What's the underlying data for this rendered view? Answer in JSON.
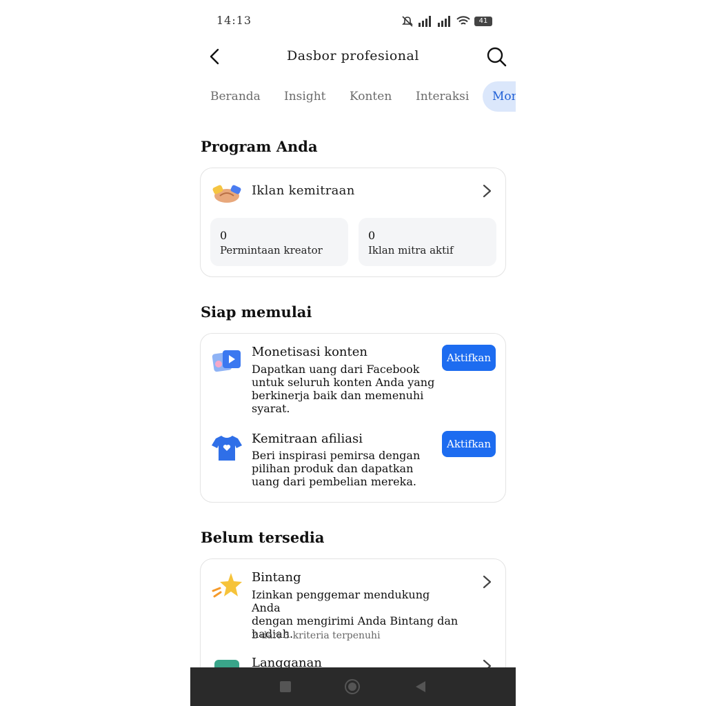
{
  "status_bar": {
    "time": "14:13",
    "battery": "41"
  },
  "header": {
    "title": "Dasbor profesional"
  },
  "tabs": [
    "Beranda",
    "Insight",
    "Konten",
    "Interaksi",
    "Mon"
  ],
  "program": {
    "section_title": "Program Anda",
    "card_title": "Iklan kemitraan",
    "stats": [
      {
        "value": "0",
        "label": "Permintaan kreator"
      },
      {
        "value": "0",
        "label": "Iklan mitra aktif"
      }
    ]
  },
  "ready": {
    "section_title": "Siap memulai",
    "items": [
      {
        "title": "Monetisasi konten",
        "desc_lines": [
          "Dapatkan uang dari Facebook",
          "untuk seluruh konten Anda yang",
          "berkinerja baik dan memenuhi",
          "syarat."
        ],
        "button": "Aktifkan",
        "icon": "video-monetization-icon"
      },
      {
        "title": "Kemitraan afiliasi",
        "desc_lines": [
          "Beri inspirasi pemirsa dengan",
          "pilihan produk dan dapatkan",
          "uang dari pembelian mereka."
        ],
        "button": "Aktifkan",
        "icon": "tshirt-icon"
      }
    ]
  },
  "unavailable": {
    "section_title": "Belum tersedia",
    "items": [
      {
        "title": "Bintang",
        "desc_lines": [
          "Izinkan penggemar mendukung Anda",
          "dengan mengirimi Anda Bintang dan",
          "hadiah."
        ],
        "meta": "2 dari 3 kriteria terpenuhi",
        "icon": "star-icon"
      },
      {
        "title": "Langganan",
        "icon": "subscription-icon"
      }
    ]
  },
  "colors": {
    "accent": "#1d6cf0",
    "tab_active_bg": "#dbe7fb",
    "nav_bg": "#2a2a2a"
  }
}
